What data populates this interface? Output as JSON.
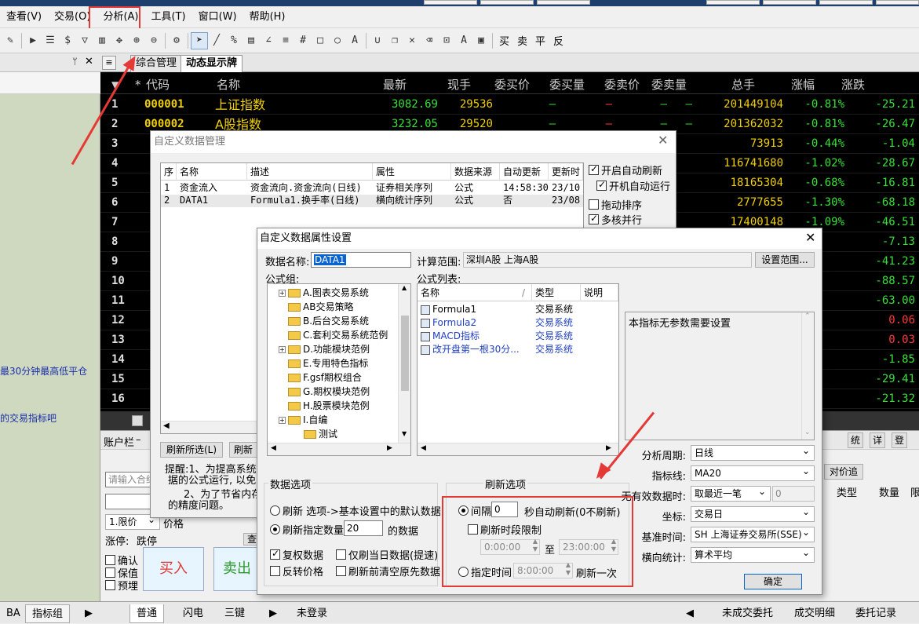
{
  "menu": {
    "items": [
      "查看(V)",
      "交易(O)",
      "分析(A)",
      "工具(T)",
      "窗口(W)",
      "帮助(H)"
    ],
    "highlighted": "分析(A)"
  },
  "toolbar": {
    "text_items": [
      "买",
      "卖",
      "平",
      "反"
    ]
  },
  "left_panel": {
    "link1": "最30分钟最高低平仓",
    "link2": "的交易指标吧",
    "bottom_tabs": [
      "BA",
      "指标组"
    ]
  },
  "quote": {
    "tabs": [
      "综合管理",
      "动态显示牌"
    ],
    "active_tab": "动态显示牌",
    "headers": [
      "*",
      "代码",
      "名称",
      "最新",
      "现手",
      "委买价",
      "委买量",
      "委卖价",
      "委卖量",
      "总手",
      "涨幅",
      "涨跌"
    ],
    "rows": [
      {
        "no": "1",
        "code": "000001",
        "name": "上证指数",
        "last": "3082.69",
        "vol": "29536",
        "bid": "—",
        "bidv": "—",
        "ask": "—",
        "askv": "—",
        "total": "201449104",
        "pct": "-0.81%",
        "chg": "-25.21"
      },
      {
        "no": "2",
        "code": "000002",
        "name": "A股指数",
        "last": "3232.05",
        "vol": "29520",
        "bid": "—",
        "bidv": "—",
        "ask": "—",
        "askv": "—",
        "total": "201362032",
        "pct": "-0.81%",
        "chg": "-26.47"
      },
      {
        "no": "3",
        "total": "73913",
        "pct": "-0.44%",
        "chg": "-1.04"
      },
      {
        "no": "4",
        "total": "116741680",
        "pct": "-1.02%",
        "chg": "-28.67"
      },
      {
        "no": "5",
        "total": "18165304",
        "pct": "-0.68%",
        "chg": "-16.81"
      },
      {
        "no": "6",
        "total": "2777655",
        "pct": "-1.30%",
        "chg": "-68.18"
      },
      {
        "no": "7",
        "total": "17400148",
        "pct": "-1.09%",
        "chg": "-46.51"
      },
      {
        "no": "8",
        "chg": "-7.13"
      },
      {
        "no": "9",
        "chg": "-41.23"
      },
      {
        "no": "10",
        "chg": "-88.57"
      },
      {
        "no": "11",
        "chg": "-63.00"
      },
      {
        "no": "12",
        "chg": "0.06"
      },
      {
        "no": "13",
        "chg": "0.03"
      },
      {
        "no": "14",
        "chg": "-1.85"
      },
      {
        "no": "15",
        "chg": "-29.41"
      },
      {
        "no": "16",
        "chg": "-21.32"
      }
    ]
  },
  "account": {
    "title": "账户栏",
    "search_placeholder": "请输入合约",
    "order_type": "1.限价",
    "price_label": "价格",
    "limit_up": "涨停:",
    "limit_down": "跌停",
    "confirm": "确认",
    "hold": "保值",
    "preorder": "预埋",
    "buy": "买入",
    "sell": "卖出",
    "query_btn": "查",
    "right_btns": [
      "统",
      "详",
      "登"
    ],
    "right_tab": "对价追",
    "right_cols": [
      "类型",
      "数量",
      "限"
    ]
  },
  "bottombar": {
    "tabs": [
      "普通",
      "闪电",
      "三键"
    ],
    "status": "未登录",
    "right_tabs": [
      "未成交委托",
      "成交明细",
      "委托记录"
    ]
  },
  "dlg1": {
    "title": "自定义数据管理",
    "columns": [
      "序",
      "名称",
      "描述",
      "属性",
      "数据来源",
      "自动更新",
      "更新时"
    ],
    "rows": [
      [
        "1",
        "资金流入",
        "资金流向.资金流向(日线)",
        "证券相关序列",
        "公式",
        "14:58:30",
        "23/10"
      ],
      [
        "2",
        "DATA1",
        "Formula1.换手率(日线)",
        "横向统计序列",
        "公式",
        "否",
        "23/08"
      ]
    ],
    "options": [
      {
        "label": "开启自动刷新",
        "checked": true
      },
      {
        "label": "开机自动运行",
        "checked": true
      },
      {
        "label": "拖动排序",
        "checked": false
      },
      {
        "label": "多核并行",
        "checked": true
      }
    ],
    "btn_refresh_sel": "刷新所选(L)",
    "btn_refresh_new": "刷新",
    "tip1": "提醒:1、为提高系统稳",
    "tip2": "据的公式运行, 以免出",
    "tip3": "2、为了节省内存",
    "tip4": "的精度问题。"
  },
  "dlg2": {
    "title": "自定义数据属性设置",
    "data_name_label": "数据名称:",
    "data_name_value": "DATA1",
    "calc_range_label": "计算范围:",
    "calc_range_value": "深圳A股  上海A股",
    "set_range_btn": "设置范围...",
    "formula_group_label": "公式组:",
    "formula_list_label": "公式列表:",
    "tree": [
      {
        "label": "A.图表交易系统",
        "expand": true
      },
      {
        "label": "AB交易策略",
        "expand": false
      },
      {
        "label": "B.后台交易系统",
        "expand": false
      },
      {
        "label": "C.套利交易系统范例",
        "expand": false
      },
      {
        "label": "D.功能模块范例",
        "expand": true
      },
      {
        "label": "E.专用特色指标",
        "expand": false
      },
      {
        "label": "F.gsf期权组合",
        "expand": false
      },
      {
        "label": "G.期权模块范例",
        "expand": false
      },
      {
        "label": "H.股票模块范例",
        "expand": false
      },
      {
        "label": "I.自编",
        "expand": true
      },
      {
        "label": "测试",
        "expand": false
      }
    ],
    "list_cols": [
      "名称",
      "类型",
      "说明"
    ],
    "list_rows": [
      {
        "name": "Formula1",
        "type": "交易系统",
        "color": "#000000"
      },
      {
        "name": "Formula2",
        "type": "交易系统",
        "color": "#1f3fbf"
      },
      {
        "name": "MACD指标",
        "type": "交易系统",
        "color": "#1f3fbf"
      },
      {
        "name": "改开盘第一根30分...",
        "type": "交易系统",
        "color": "#1f3fbf"
      }
    ],
    "desc_text": "本指标无参数需要设置",
    "fields": [
      {
        "label": "分析周期:",
        "value": "日线"
      },
      {
        "label": "指标线:",
        "value": "MA20"
      },
      {
        "label": "无有效数据时:",
        "value": "取最近一笔",
        "extra": "0"
      },
      {
        "label": "坐标:",
        "value": "交易日"
      },
      {
        "label": "基准时间:",
        "value": "SH 上海证券交易所(SSE)"
      },
      {
        "label": "横向统计:",
        "value": "算术平均"
      }
    ],
    "data_opts_title": "数据选项",
    "data_radio1": "刷新 选项->基本设置中的默认数据",
    "data_radio2_pre": "刷新指定数量",
    "data_count": "20",
    "data_radio2_post": "的数据",
    "data_checks": [
      {
        "label": "复权数据",
        "checked": true
      },
      {
        "label": "仅刷当日数据(提速)",
        "checked": false
      },
      {
        "label": "反转价格",
        "checked": false
      },
      {
        "label": "刷新前清空原先数据",
        "checked": false
      }
    ],
    "refresh_title": "刷新选项",
    "interval_label": "间隔",
    "interval_value": "0",
    "interval_suffix": "秒自动刷新(0不刷新)",
    "period_limit": "刷新时段限制",
    "time_from": "0:00:00",
    "time_to_label": "至",
    "time_to": "23:00:00",
    "fixed_time_label": "指定时间",
    "fixed_time": "8:00:00",
    "fixed_time_suffix": "刷新一次",
    "ok_btn": "确定"
  }
}
